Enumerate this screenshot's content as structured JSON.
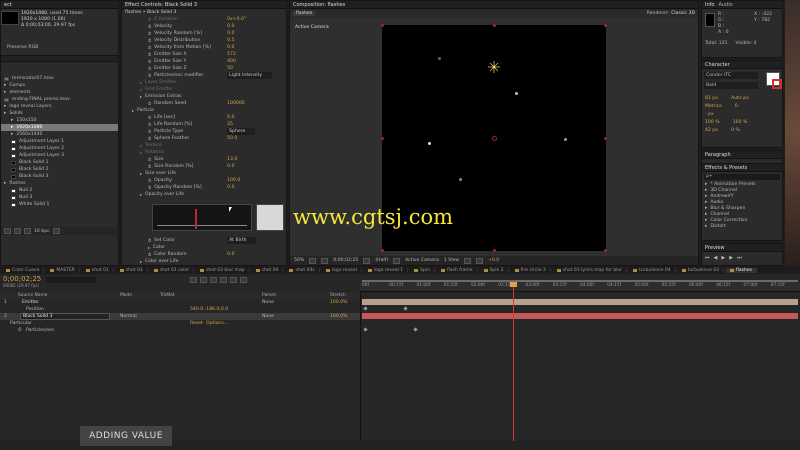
{
  "project": {
    "tab": "ect",
    "comp_name": "1920x1080",
    "used_times": ", used 75 times",
    "dims": "1920 x 1080 (1.00)",
    "fps": "Δ 0;00;03;00, 29.97 fps",
    "color": "Preserve RGB",
    "items": [
      {
        "label": "terminator07.mov",
        "indent": 0,
        "sel": false,
        "color": "#7a6aa0"
      },
      {
        "label": "Comps",
        "indent": 0,
        "sel": false,
        "color": ""
      },
      {
        "label": "elements",
        "indent": 0,
        "sel": false,
        "color": ""
      },
      {
        "label": "ending FINAL prores.mov",
        "indent": 0,
        "sel": false,
        "color": "#7a6aa0"
      },
      {
        "label": "logo reveal Layers",
        "indent": 0,
        "sel": false,
        "color": ""
      },
      {
        "label": "Solids",
        "indent": 0,
        "sel": false,
        "color": ""
      },
      {
        "label": "150x150",
        "indent": 1,
        "sel": false,
        "color": ""
      },
      {
        "label": "1920x1080",
        "indent": 1,
        "sel": true,
        "color": ""
      },
      {
        "label": "2560x1440",
        "indent": 1,
        "sel": false,
        "color": ""
      },
      {
        "label": "Adjustment Layer 1",
        "indent": 1,
        "sel": false,
        "color": "#ffffff"
      },
      {
        "label": "Adjustment Layer 2",
        "indent": 1,
        "sel": false,
        "color": "#ffffff"
      },
      {
        "label": "Adjustment Layer 3",
        "indent": 1,
        "sel": false,
        "color": "#ffffff"
      },
      {
        "label": "Black Solid 1",
        "indent": 1,
        "sel": false,
        "color": "#000000"
      },
      {
        "label": "Black Solid 2",
        "indent": 1,
        "sel": false,
        "color": "#000000"
      },
      {
        "label": "Black Solid 3",
        "indent": 1,
        "sel": false,
        "color": "#000000"
      },
      {
        "label": "flashes",
        "indent": 0,
        "sel": false,
        "color": ""
      },
      {
        "label": "Null 2",
        "indent": 1,
        "sel": false,
        "color": "#ffffff"
      },
      {
        "label": "Null 3",
        "indent": 1,
        "sel": false,
        "color": "#ffffff"
      },
      {
        "label": "White Solid 1",
        "indent": 1,
        "sel": false,
        "color": "#ffffff"
      }
    ],
    "bpc": "16 bpc"
  },
  "effect_controls": {
    "tab": "Effect Controls: Black Solid 3",
    "subtitle": "flashes • Black Solid 3",
    "rows": [
      {
        "label": "Z Rotation",
        "value": "0x+0.0°",
        "indent": 2,
        "dim": true
      },
      {
        "label": "Velocity",
        "value": "0.0",
        "indent": 2
      },
      {
        "label": "Velocity Random [%]",
        "value": "0.0",
        "indent": 2
      },
      {
        "label": "Velocity Distribution",
        "value": "0.5",
        "indent": 2
      },
      {
        "label": "Velocity from Motion [%]",
        "value": "0.0",
        "indent": 2
      },
      {
        "label": "Emitter Size X",
        "value": "572",
        "indent": 2
      },
      {
        "label": "Emitter Size Y",
        "value": "400",
        "indent": 2
      },
      {
        "label": "Emitter Size Z",
        "value": "50",
        "indent": 2
      },
      {
        "label": "Particles/sec modifier",
        "value": "Light Intensity",
        "indent": 2
      },
      {
        "label": "Layer Emitter",
        "value": "",
        "indent": 1,
        "dim": true
      },
      {
        "label": "Grid Emitter",
        "value": "",
        "indent": 1,
        "dim": true
      },
      {
        "label": "Emission Extras",
        "value": "",
        "indent": 1
      },
      {
        "label": "Random Seed",
        "value": "100000",
        "indent": 2
      },
      {
        "label": "Particle",
        "value": "",
        "indent": 0
      },
      {
        "label": "Life [sec]",
        "value": "6.0",
        "indent": 2
      },
      {
        "label": "Life Random [%]",
        "value": "25",
        "indent": 2
      },
      {
        "label": "Particle Type",
        "value": "Sphere",
        "indent": 2
      },
      {
        "label": "Sphere Feather",
        "value": "50.0",
        "indent": 2
      },
      {
        "label": "Texture",
        "value": "",
        "indent": 1,
        "dim": true
      },
      {
        "label": "Rotation",
        "value": "",
        "indent": 1,
        "dim": true
      },
      {
        "label": "Size",
        "value": "13.0",
        "indent": 2
      },
      {
        "label": "Size Random [%]",
        "value": "0.0",
        "indent": 2
      },
      {
        "label": "Size over Life",
        "value": "",
        "indent": 1
      },
      {
        "label": "Opacity",
        "value": "100.0",
        "indent": 2
      },
      {
        "label": "Opacity Random [%]",
        "value": "0.0",
        "indent": 2
      },
      {
        "label": "Opacity over Life",
        "value": "",
        "indent": 1
      }
    ],
    "bottom_rows": [
      {
        "label": "Set Color",
        "value": "At Birth",
        "indent": 2
      },
      {
        "label": "Color",
        "value": "",
        "indent": 2
      },
      {
        "label": "Color Random",
        "value": "0.0",
        "indent": 2
      },
      {
        "label": "Color over Life",
        "value": "",
        "indent": 1
      }
    ]
  },
  "composition": {
    "tab": "Composition: flashes",
    "subtab": "flashes",
    "renderer_label": "Renderer:",
    "renderer": "Classic 3D",
    "camera_label": "Active Camera",
    "zoom": "50%",
    "timecode": "0;00;02;25",
    "quality": "(Half)",
    "view": "Active Camera",
    "views": "1 View",
    "exposure": "+0.0"
  },
  "watermark": "www.cgtsj.com",
  "info_panel": {
    "tabs": [
      "Info",
      "Audio"
    ],
    "r": "R :",
    "g": "G :",
    "b": "B :",
    "a": "A : 0",
    "x": "X : -422",
    "y": "Y : 782",
    "total": "Total: 131",
    "visible": "Visible: 4"
  },
  "character": {
    "tab": "Character",
    "font": "Condor ITC",
    "style": "Bold",
    "size": "81 px",
    "leading": "Auto px",
    "kerning": "Metrics",
    "tracking": "0",
    "stroke": "- px",
    "vscale": "100 %",
    "hscale": "100 %",
    "baseline": "42 px",
    "tsume": "0 %"
  },
  "paragraph": {
    "tab": "Paragraph",
    "values": [
      "0 px",
      "0 px",
      "0 px",
      "0 px"
    ]
  },
  "effects_presets": {
    "tab": "Effects & Presets",
    "search": "ρ+",
    "items": [
      "* Animation Presets",
      "3D Channel",
      "AndrewVY",
      "Audio",
      "Blur & Sharpen",
      "Channel",
      "Color Correction",
      "Distort"
    ]
  },
  "preview": {
    "tab": "Preview"
  },
  "timeline": {
    "tabs": [
      "Color Cuave",
      "MASTER",
      "shot 01",
      "shot 03",
      "shot 03 color",
      "shot 03 blur map",
      "shot 04",
      "shot 04c",
      "logo reveal",
      "logo reveal 1",
      "Spin",
      "flash frame",
      "Spin 2",
      "fire circle 3",
      "shot 03 lyrics map for blur",
      "turbulence 04",
      "turbulence 03",
      "flashes"
    ],
    "active_tab": "flashes",
    "timecode": "0;00;02;25",
    "fps_note": "00085 (29.97 fps)",
    "headers": {
      "source": "Source Name",
      "mode": "Mode",
      "trkmat": "TrkMat",
      "parent": "Parent",
      "stretch": "Stretch"
    },
    "ruler": [
      "00f",
      "00:15f",
      "01:00f",
      "01:15f",
      "02:00f",
      "02:15f",
      "03:00f",
      "03:15f",
      "04:00f",
      "04:15f",
      "05:00f",
      "05:15f",
      "06:00f",
      "06:15f",
      "07:00f",
      "07:15f"
    ],
    "layers": [
      {
        "num": "1",
        "name": "Emitter",
        "mode": "",
        "parent": "None",
        "stretch": "100.0%"
      },
      {
        "num": "",
        "name": "Position",
        "value": "540.0,-186.0,0.0",
        "mode": "",
        "parent": "",
        "stretch": ""
      },
      {
        "num": "2",
        "name": "Black Solid 3",
        "mode": "Normal",
        "parent": "None",
        "stretch": "100.0%"
      },
      {
        "num": "",
        "name": "Particular",
        "reset": "Reset",
        "options": "Options...",
        "mode": "",
        "parent": "",
        "stretch": ""
      },
      {
        "num": "",
        "name": "Particles/sec",
        "mode": "",
        "parent": "",
        "stretch": ""
      }
    ],
    "caption": "ADDING VALUE"
  }
}
